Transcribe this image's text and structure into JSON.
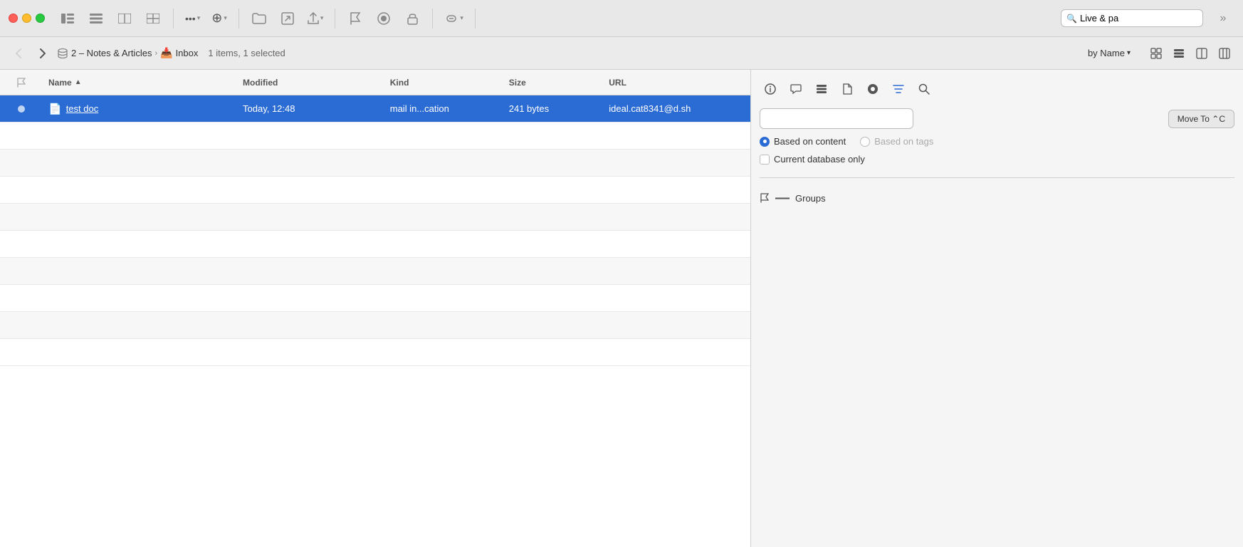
{
  "titlebar": {
    "traffic_lights": [
      "red",
      "yellow",
      "green"
    ],
    "buttons": [
      {
        "name": "sidebar-toggle",
        "symbol": "⊟"
      },
      {
        "name": "view-list",
        "symbol": "≡"
      },
      {
        "name": "view-split",
        "symbol": "⊡"
      },
      {
        "name": "view-outline",
        "symbol": "☰"
      }
    ],
    "more_button": "•••",
    "add_button": "⊕",
    "folder_button": "🗂",
    "share_button": "⬆",
    "flag_button": "⚑",
    "record_button": "⏺",
    "lock_button": "🔒",
    "link_button": "🔗",
    "live_search_placeholder": "Live & pa",
    "expand_button": "»"
  },
  "navbar": {
    "back_button": "‹",
    "forward_button": "›",
    "breadcrumb": {
      "db_icon": "⊕",
      "db_name": "2 – Notes & Articles",
      "arrow": "›",
      "inbox_icon": "📧",
      "inbox_name": "Inbox"
    },
    "item_count": "1 items, 1 selected",
    "sort_label": "by Name",
    "sort_arrow": "▾",
    "view_icons": [
      "⊞",
      "☰",
      "⊟",
      "⊞⊟"
    ]
  },
  "file_list": {
    "columns": [
      {
        "name": "flag",
        "label": ""
      },
      {
        "name": "name",
        "label": "Name",
        "sort_arrow": "▲"
      },
      {
        "name": "modified",
        "label": "Modified"
      },
      {
        "name": "kind",
        "label": "Kind"
      },
      {
        "name": "size",
        "label": "Size"
      },
      {
        "name": "url",
        "label": "URL"
      }
    ],
    "rows": [
      {
        "selected": true,
        "flag_color": "orange",
        "doc_icon": "📄",
        "name": "test doc",
        "modified": "Today, 12:48",
        "kind": "mail in...cation",
        "size": "241 bytes",
        "url": "ideal.cat8341@d.sh"
      }
    ],
    "empty_rows": 8
  },
  "right_panel": {
    "toolbar_buttons": [
      {
        "name": "info",
        "symbol": "ⓘ"
      },
      {
        "name": "annotation",
        "symbol": "💬"
      },
      {
        "name": "list",
        "symbol": "☰"
      },
      {
        "name": "doc",
        "symbol": "📄"
      },
      {
        "name": "circle",
        "symbol": "⬤"
      },
      {
        "name": "lines",
        "symbol": "≡"
      },
      {
        "name": "search",
        "symbol": "🔍"
      }
    ],
    "search_placeholder": "",
    "move_to_label": "Move To ⌃C",
    "search_options": [
      {
        "id": "content",
        "label": "Based on content",
        "selected": true
      },
      {
        "id": "tags",
        "label": "Based on tags",
        "selected": false
      }
    ],
    "current_db_only": {
      "label": "Current database only",
      "checked": false
    },
    "groups_label": "Groups"
  }
}
